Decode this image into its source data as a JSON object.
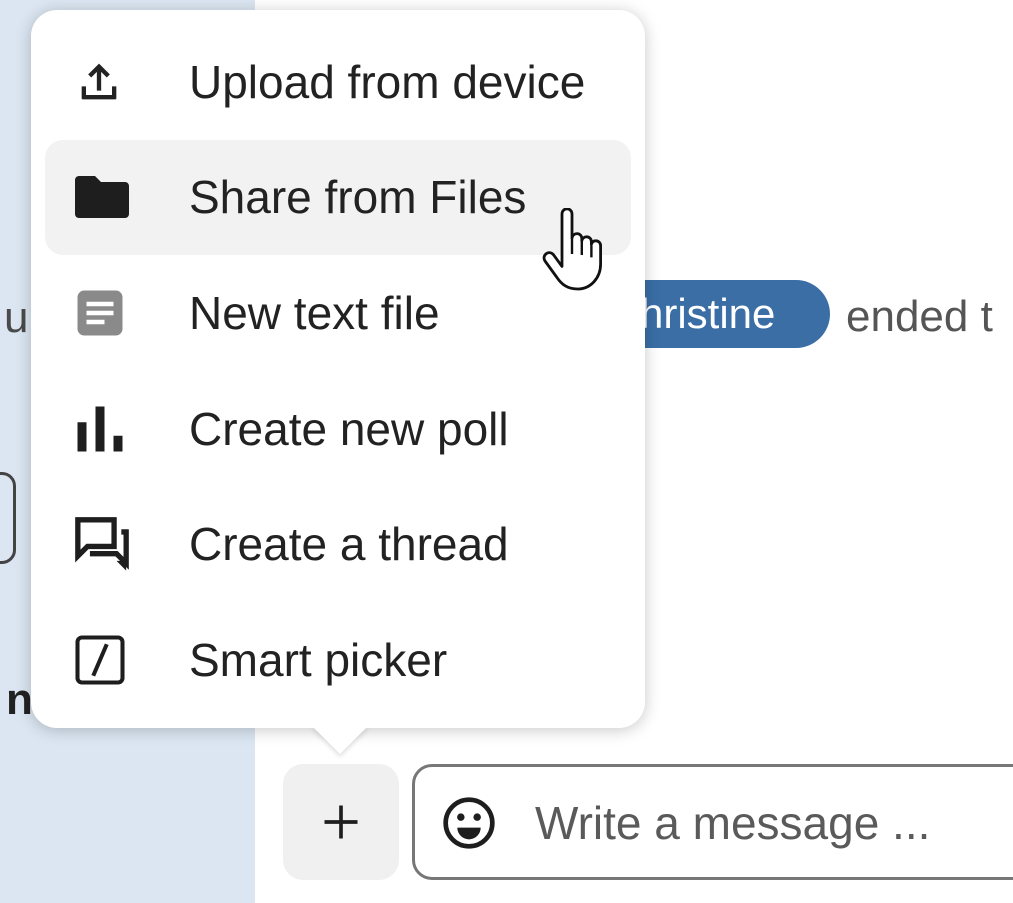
{
  "background": {
    "fragment_left_top": "u",
    "fragment_left_bottom": "n",
    "mention": "hristine",
    "system_message_fragment": "ended t"
  },
  "menu": {
    "items": [
      {
        "label": "Upload from device",
        "icon": "upload-icon"
      },
      {
        "label": "Share from Files",
        "icon": "folder-icon",
        "hovered": true
      },
      {
        "label": "New text file",
        "icon": "text-file-icon"
      },
      {
        "label": "Create new poll",
        "icon": "poll-icon"
      },
      {
        "label": "Create a thread",
        "icon": "thread-icon"
      },
      {
        "label": "Smart picker",
        "icon": "smart-picker-icon"
      }
    ]
  },
  "composer": {
    "add_button_icon": "plus-icon",
    "emoji_icon": "emoji-icon",
    "placeholder": "Write a message ..."
  },
  "colors": {
    "accent": "#3a6ea5",
    "sidebar_bg": "#dbe6f2",
    "hover_bg": "#f2f2f2"
  }
}
